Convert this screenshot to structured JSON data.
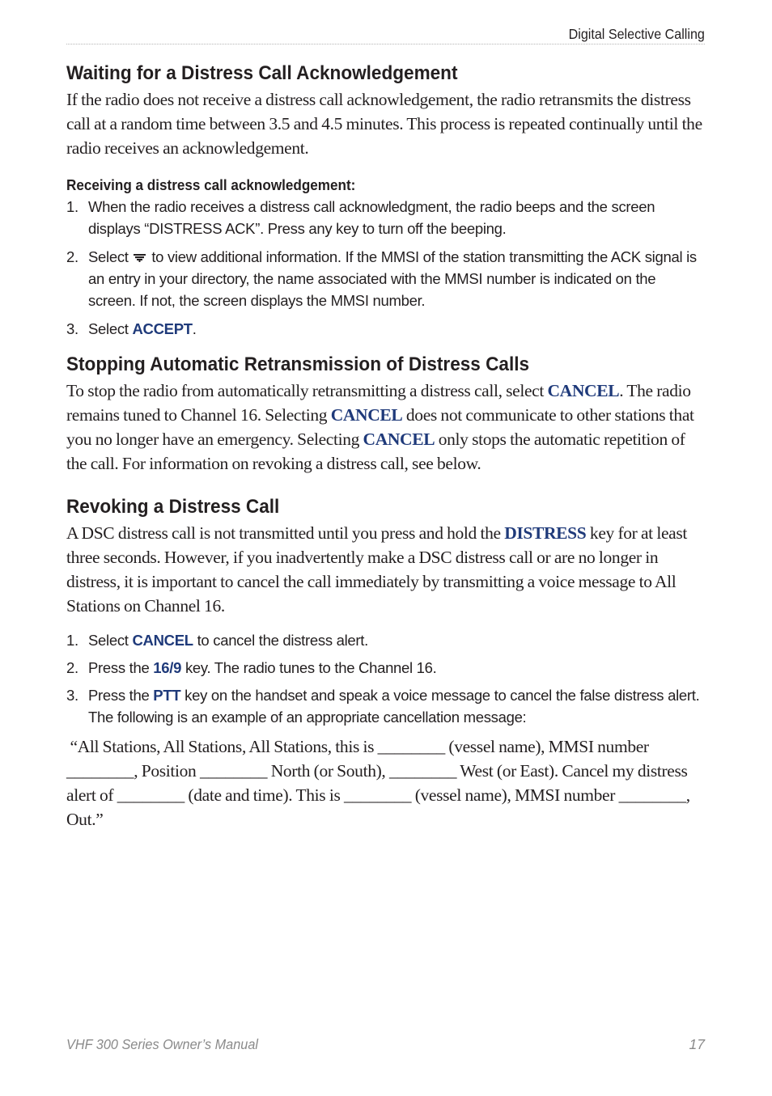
{
  "header": {
    "section_title": "Digital Selective Calling"
  },
  "sections": {
    "waiting": {
      "title": "Waiting for a Distress Call Acknowledgement",
      "paragraph": "If the radio does not receive a distress call acknowledgement, the radio retransmits the distress call at a random time between 3.5 and 4.5 minutes. This process is repeated continually until the radio receives an acknowledgement.",
      "subheading": "Receiving a distress call acknowledgement:",
      "steps": [
        {
          "num": "1.",
          "text": "When the radio receives a distress call acknowledgment, the radio beeps and the screen displays “DISTRESS ACK”. Press any key to turn off the beeping."
        },
        {
          "num": "2.",
          "text_before": "Select",
          "icon": "menu-key-icon",
          "text_after": "to view additional information. If the MMSI of the station transmitting the ACK signal is an entry in your directory, the name associated with the MMSI number is indicated on the screen. If not, the screen displays the MMSI number."
        },
        {
          "num": "3.",
          "text_before": "Select ",
          "keyword": "ACCEPT",
          "text_after": "."
        }
      ]
    },
    "stopping": {
      "title": "Stopping Automatic Retransmission of Distress Calls",
      "p1": "To stop the radio from automatically retransmitting a distress call, select ",
      "kw1": "CANCEL",
      "p2": ". The radio remains tuned to Channel 16. Selecting ",
      "kw2": "CANCEL",
      "p3": " does not communicate to other stations that you no longer have an emergency. Selecting ",
      "kw3": "CANCEL",
      "p4": " only stops the automatic repetition of the call. For information on revoking a distress call, see below."
    },
    "revoking": {
      "title": "Revoking a Distress Call",
      "p1": "A DSC distress call is not transmitted until you press and hold the ",
      "kw1": "DISTRESS",
      "p2": " key for at least three seconds. However, if you inadvertently make a DSC distress call or are no longer in distress, it is important to cancel the call immediately by transmitting a voice message to All Stations on Channel 16.",
      "steps": [
        {
          "num": "1.",
          "text_before": "Select ",
          "keyword": "CANCEL",
          "text_after": " to cancel the distress alert."
        },
        {
          "num": "2.",
          "text_before": "Press the ",
          "keyword": "16/9",
          "text_after": " key. The radio tunes to the Channel 16."
        },
        {
          "num": "3.",
          "text_before": "Press the ",
          "keyword": "PTT",
          "text_after": " key on the handset and speak a voice message to cancel the false distress alert. The following is an example of an appropriate cancellation message:"
        }
      ],
      "example_message": " “All Stations, All Stations, All Stations, this is ________ (vessel name), MMSI number ________, Position ________ North (or South), ________ West (or East). Cancel my distress alert of ________ (date and time). This is ________ (vessel name), MMSI number ________, Out.”"
    }
  },
  "footer": {
    "manual_title": "VHF 300 Series Owner’s Manual",
    "page_number": "17"
  },
  "colors": {
    "keyword": "#1f3a7a",
    "text": "#231f20",
    "footer": "#8a8a8a"
  }
}
